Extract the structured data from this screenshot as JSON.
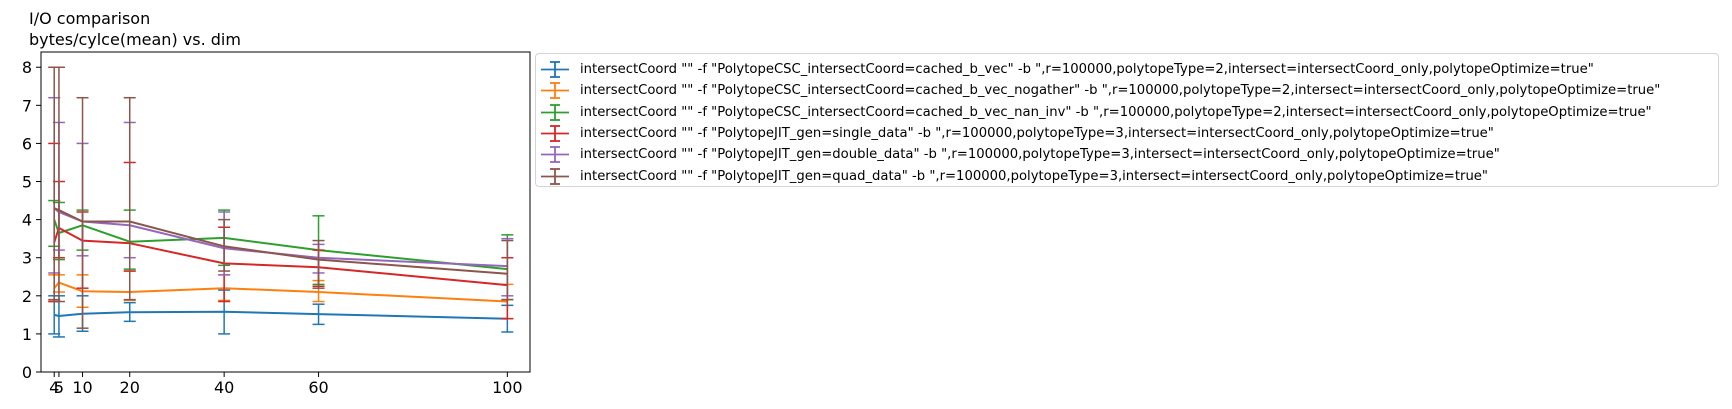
{
  "chart_data": {
    "type": "line",
    "title": "I/O comparison",
    "subtitle": "bytes/cylce(mean) vs. dim",
    "xlabel": "",
    "ylabel": "",
    "x": [
      4,
      5,
      10,
      20,
      40,
      60,
      100
    ],
    "x_ticks": [
      4,
      5,
      10,
      20,
      40,
      60,
      100
    ],
    "y_ticks": [
      0,
      1,
      2,
      3,
      4,
      5,
      6,
      7,
      8
    ],
    "xlim": [
      1.2,
      104.8
    ],
    "ylim": [
      0,
      8.4
    ],
    "grid": false,
    "legend_position": "outside-right-top",
    "error_bars": true,
    "series": [
      {
        "name": "intersectCoord \"\" -f \"PolytopeCSC_intersectCoord=cached_b_vec\" -b \",r=100000,polytopeType=2,intersect=intersectCoord_only,polytopeOptimize=true\"",
        "color": "#1f77b4",
        "values": [
          1.5,
          1.47,
          1.53,
          1.57,
          1.58,
          1.52,
          1.4
        ],
        "err_low": [
          1.0,
          0.92,
          1.07,
          1.33,
          1.0,
          1.25,
          1.05
        ],
        "err_high": [
          2.0,
          2.0,
          2.0,
          1.82,
          2.15,
          1.78,
          1.75
        ]
      },
      {
        "name": "intersectCoord \"\" -f \"PolytopeCSC_intersectCoord=cached_b_vec_nogather\" -b \",r=100000,polytopeType=2,intersect=intersectCoord_only,polytopeOptimize=true\"",
        "color": "#ff7f0e",
        "values": [
          2.2,
          2.35,
          2.12,
          2.1,
          2.2,
          2.1,
          1.85
        ],
        "err_low": [
          1.85,
          2.1,
          1.7,
          1.88,
          1.88,
          1.85,
          1.4
        ],
        "err_high": [
          2.55,
          2.55,
          2.55,
          2.65,
          2.55,
          2.4,
          2.3
        ]
      },
      {
        "name": "intersectCoord \"\" -f \"PolytopeCSC_intersectCoord=cached_b_vec_nan_inv\" -b \",r=100000,polytopeType=2,intersect=intersectCoord_only,polytopeOptimize=true\"",
        "color": "#2ca02c",
        "values": [
          4.0,
          3.65,
          3.85,
          3.42,
          3.52,
          3.2,
          2.7
        ],
        "err_low": [
          3.3,
          2.95,
          3.2,
          2.7,
          2.8,
          2.3,
          1.9
        ],
        "err_high": [
          4.5,
          4.45,
          4.25,
          4.25,
          4.25,
          4.1,
          3.6
        ]
      },
      {
        "name": "intersectCoord \"\" -f \"PolytopeJIT_gen=single_data\" -b \",r=100000,polytopeType=3,intersect=intersectCoord_only,polytopeOptimize=true\"",
        "color": "#d62728",
        "values": [
          3.4,
          3.78,
          3.45,
          3.38,
          2.85,
          2.75,
          2.28
        ],
        "err_low": [
          1.85,
          3.0,
          2.2,
          2.65,
          1.85,
          2.25,
          1.4
        ],
        "err_high": [
          6.0,
          5.0,
          4.2,
          5.5,
          3.8,
          3.2,
          3.0
        ]
      },
      {
        "name": "intersectCoord \"\" -f \"PolytopeJIT_gen=double_data\" -b \",r=100000,polytopeType=3,intersect=intersectCoord_only,polytopeOptimize=true\"",
        "color": "#9467bd",
        "values": [
          4.3,
          4.2,
          3.95,
          3.85,
          3.25,
          3.0,
          2.78
        ],
        "err_low": [
          2.6,
          3.2,
          3.05,
          3.0,
          2.55,
          2.6,
          2.0
        ],
        "err_high": [
          7.2,
          6.55,
          6.0,
          6.55,
          4.2,
          3.35,
          3.5
        ]
      },
      {
        "name": "intersectCoord \"\" -f \"PolytopeJIT_gen=quad_data\" -b \",r=100000,polytopeType=3,intersect=intersectCoord_only,polytopeOptimize=true\"",
        "color": "#8c564b",
        "values": [
          4.3,
          4.25,
          3.95,
          3.95,
          3.3,
          2.95,
          2.58
        ],
        "err_low": [
          1.9,
          1.85,
          1.15,
          1.9,
          2.65,
          2.2,
          1.9
        ],
        "err_high": [
          8.0,
          8.0,
          7.2,
          7.2,
          4.0,
          3.45,
          3.45
        ]
      }
    ]
  }
}
